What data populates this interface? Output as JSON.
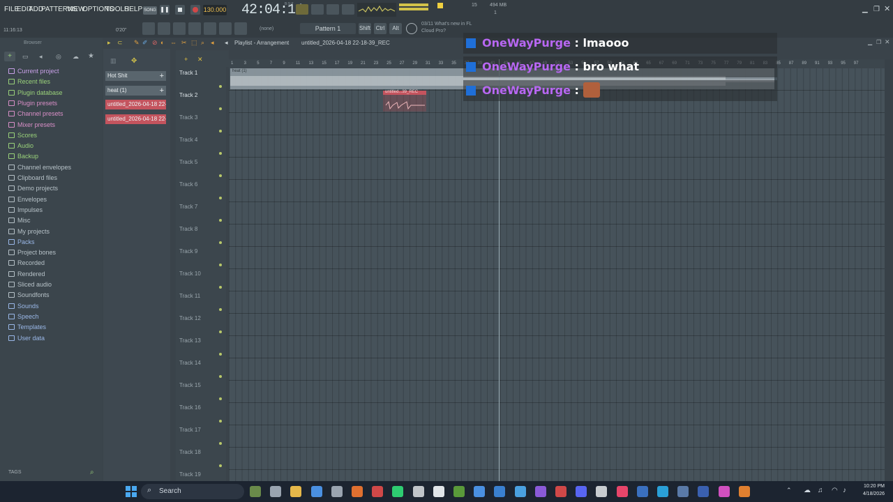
{
  "menu": [
    "FILE",
    "EDIT",
    "ADD",
    "PATTERNS",
    "VIEW",
    "OPTIONS",
    "TOOLS",
    "HELP"
  ],
  "transport": {
    "mode": "SONG",
    "tempo": "130.000",
    "time": "42:04:14",
    "time_small": "B:S:T",
    "cpu": "15",
    "mem": "494 MB",
    "voices": "1"
  },
  "hint_line": {
    "line1": "11:16:13",
    "line2": "0'20\""
  },
  "pattern": {
    "label": "Pattern 1",
    "none_label": "(none)"
  },
  "mod_keys": [
    "Shift",
    "Ctrl",
    "Alt"
  ],
  "news": {
    "line1": "03/11  What's new in FL",
    "line2": "Cloud Pro?"
  },
  "browser": {
    "title": "Browser",
    "items": [
      {
        "label": "Current project",
        "color": "#c8a0e8"
      },
      {
        "label": "Recent files",
        "color": "#9ad27a"
      },
      {
        "label": "Plugin database",
        "color": "#9ad27a"
      },
      {
        "label": "Plugin presets",
        "color": "#d98fc7"
      },
      {
        "label": "Channel presets",
        "color": "#d98fc7"
      },
      {
        "label": "Mixer presets",
        "color": "#d98fc7"
      },
      {
        "label": "Scores",
        "color": "#9ad27a"
      },
      {
        "label": "Audio",
        "color": "#9ad27a"
      },
      {
        "label": "Backup",
        "color": "#9ad27a"
      },
      {
        "label": "Channel envelopes",
        "color": "#b7c2c8"
      },
      {
        "label": "Clipboard files",
        "color": "#b7c2c8"
      },
      {
        "label": "Demo projects",
        "color": "#b7c2c8"
      },
      {
        "label": "Envelopes",
        "color": "#b7c2c8"
      },
      {
        "label": "Impulses",
        "color": "#b7c2c8"
      },
      {
        "label": "Misc",
        "color": "#b7c2c8"
      },
      {
        "label": "My projects",
        "color": "#b7c2c8"
      },
      {
        "label": "Packs",
        "color": "#9ab8e8"
      },
      {
        "label": "Project bones",
        "color": "#b7c2c8"
      },
      {
        "label": "Recorded",
        "color": "#b7c2c8"
      },
      {
        "label": "Rendered",
        "color": "#b7c2c8"
      },
      {
        "label": "Sliced audio",
        "color": "#b7c2c8"
      },
      {
        "label": "Soundfonts",
        "color": "#b7c2c8"
      },
      {
        "label": "Sounds",
        "color": "#9ab8e8"
      },
      {
        "label": "Speech",
        "color": "#9ab8e8"
      },
      {
        "label": "Templates",
        "color": "#9ab8e8"
      },
      {
        "label": "User data",
        "color": "#9ab8e8"
      }
    ],
    "tags_label": "TAGS"
  },
  "channels": [
    {
      "label": "Hot Shit",
      "color": "#59656d"
    },
    {
      "label": "heat (1)",
      "color": "#5c6870"
    },
    {
      "label": "untitled_2026-04-18 22-...",
      "color": "#c4545e"
    },
    {
      "label": "untitled_2026-04-18 22-...",
      "color": "#c4545e"
    }
  ],
  "playlist": {
    "title": "Playlist - Arrangement",
    "project": "untitled_2026-04-18 22-18-39_REC"
  },
  "tracks": [
    "Track 1",
    "Track 2",
    "Track 3",
    "Track 4",
    "Track 5",
    "Track 6",
    "Track 7",
    "Track 8",
    "Track 9",
    "Track 10",
    "Track 11",
    "Track 12",
    "Track 13",
    "Track 14",
    "Track 15",
    "Track 16",
    "Track 17",
    "Track 18",
    "Track 19"
  ],
  "ruler_marks": [
    "1",
    "3",
    "5",
    "7",
    "9",
    "11",
    "13",
    "15",
    "17",
    "19",
    "21",
    "23",
    "25",
    "27",
    "29",
    "31",
    "33",
    "35",
    "37",
    "39",
    "41",
    "43",
    "45",
    "47",
    "49",
    "51",
    "53",
    "55",
    "57",
    "59",
    "61",
    "63",
    "65",
    "67",
    "69",
    "71",
    "73",
    "75",
    "77",
    "79",
    "81",
    "83",
    "85",
    "87",
    "89",
    "91",
    "93",
    "95",
    "97"
  ],
  "clips": [
    {
      "label": "heat (1)"
    },
    {
      "label": "untitled...39_REC"
    }
  ],
  "chat": [
    {
      "user": "OneWayPurge",
      "msg": "lmaooo"
    },
    {
      "user": "OneWayPurge",
      "msg": "bro what"
    },
    {
      "user": "OneWayPurge",
      "msg": ""
    }
  ],
  "taskbar": {
    "search": "Search",
    "time": "10:20 PM",
    "date": "4/18/2026"
  }
}
